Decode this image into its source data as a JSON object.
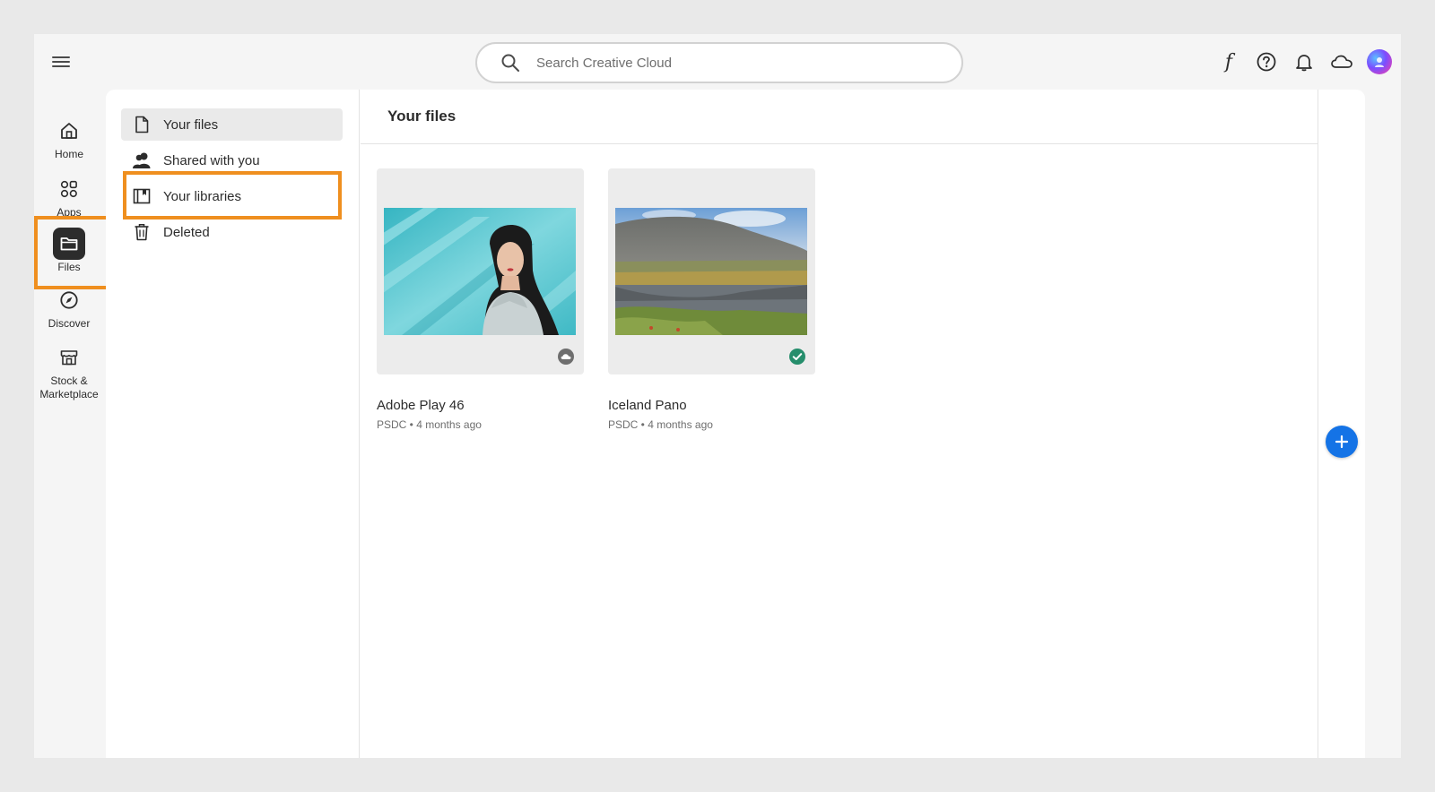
{
  "search": {
    "placeholder": "Search Creative Cloud"
  },
  "topbar": {
    "icons": [
      "menu-icon",
      "font-icon",
      "help-icon",
      "bell-icon",
      "cloud-icon",
      "avatar"
    ],
    "font_glyph": "f"
  },
  "rail": {
    "items": [
      {
        "label": "Home",
        "icon": "home-icon"
      },
      {
        "label": "Apps",
        "icon": "apps-icon"
      },
      {
        "label": "Files",
        "icon": "folder-icon",
        "active": true
      },
      {
        "label": "Discover",
        "icon": "compass-icon"
      },
      {
        "label": "Stock &",
        "label2": "Marketplace",
        "icon": "store-icon"
      }
    ]
  },
  "nav": {
    "items": [
      {
        "label": "Your files",
        "icon": "file-icon",
        "selected": true
      },
      {
        "label": "Shared with you",
        "icon": "people-icon"
      },
      {
        "label": "Your libraries",
        "icon": "library-icon",
        "highlighted": true
      },
      {
        "label": "Deleted",
        "icon": "trash-icon"
      }
    ]
  },
  "content": {
    "title": "Your files",
    "files": [
      {
        "name": "Adobe Play 46",
        "meta": "PSDC • 4 months ago",
        "status": "cloud"
      },
      {
        "name": "Iceland Pano",
        "meta": "PSDC • 4 months ago",
        "status": "synced"
      }
    ]
  },
  "colors": {
    "highlight": "#ef8f1f",
    "accent": "#1473e6",
    "synced": "#268e6c"
  }
}
